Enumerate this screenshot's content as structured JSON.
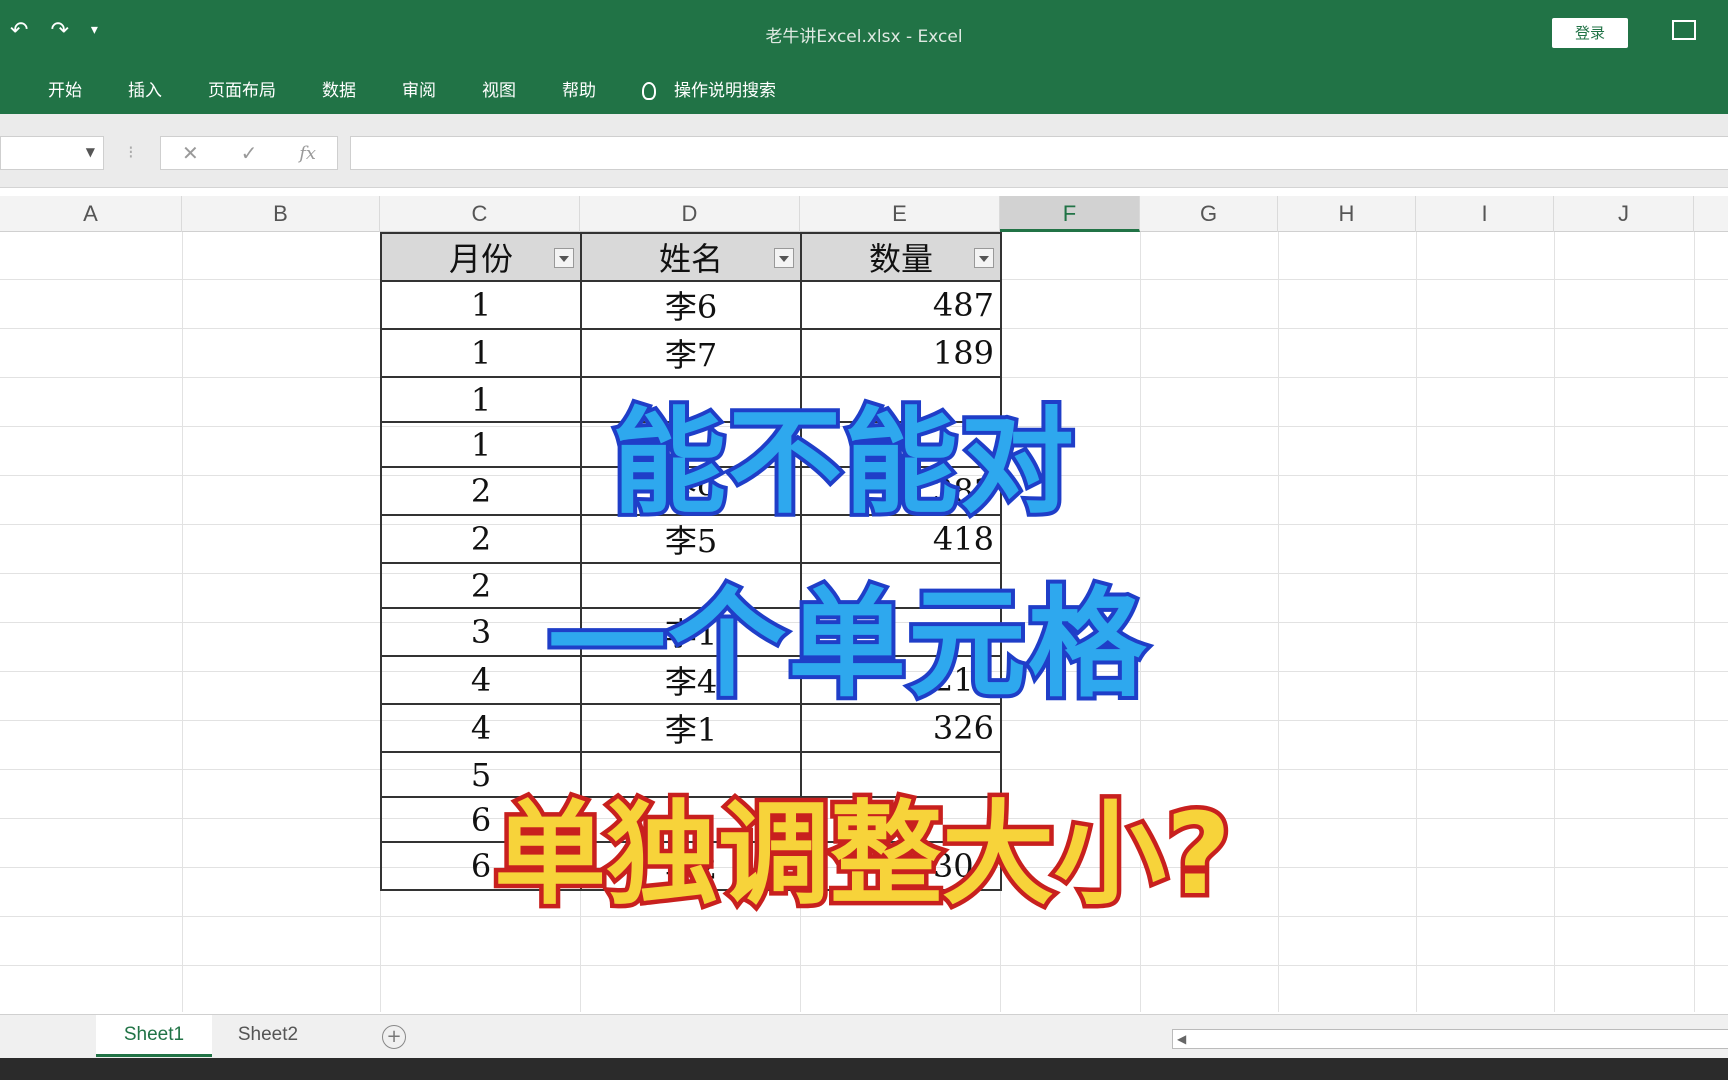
{
  "window": {
    "title": "老牛讲Excel.xlsx  -  Excel",
    "login_label": "登录"
  },
  "ribbon": {
    "tabs": [
      "开始",
      "插入",
      "页面布局",
      "数据",
      "审阅",
      "视图",
      "帮助"
    ],
    "tell_me": "操作说明搜索"
  },
  "formula_bar": {
    "cancel": "✕",
    "enter": "✓",
    "fx": "fx"
  },
  "columns": [
    "A",
    "B",
    "C",
    "D",
    "E",
    "F",
    "G",
    "H",
    "I",
    "J"
  ],
  "selected_column": "F",
  "table": {
    "headers": [
      "月份",
      "姓名",
      "数量"
    ],
    "rows": [
      [
        "1",
        "李6",
        "487"
      ],
      [
        "1",
        "李7",
        "189"
      ],
      [
        "1",
        "",
        ""
      ],
      [
        "1",
        "",
        ""
      ],
      [
        "2",
        "李9",
        "383"
      ],
      [
        "2",
        "李5",
        "418"
      ],
      [
        "2",
        "",
        ""
      ],
      [
        "3",
        "李1",
        ""
      ],
      [
        "4",
        "李4",
        "213"
      ],
      [
        "4",
        "李1",
        "326"
      ],
      [
        "5",
        "",
        ""
      ],
      [
        "6",
        "",
        ""
      ],
      [
        "6",
        "李2",
        "304"
      ]
    ]
  },
  "overlay": {
    "line1": "能不能对",
    "line2": "一个单元格",
    "line3": "单独调整大小?"
  },
  "sheets": [
    "Sheet1",
    "Sheet2"
  ],
  "colors": {
    "excel_green": "#217346",
    "overlay_blue": "#2ea8ee",
    "overlay_yellow": "#f7d33a",
    "overlay_red": "#c8201e"
  }
}
